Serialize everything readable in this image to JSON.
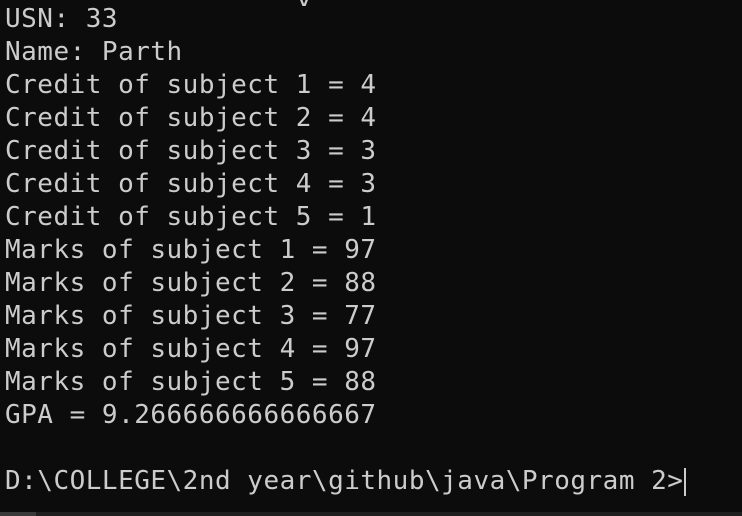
{
  "terminal": {
    "lines": [
      "USN: 33",
      "Name: Parth",
      "Credit of subject 1 = 4",
      "Credit of subject 2 = 4",
      "Credit of subject 3 = 3",
      "Credit of subject 4 = 3",
      "Credit of subject 5 = 1",
      "Marks of subject 1 = 97",
      "Marks of subject 2 = 88",
      "Marks of subject 3 = 77",
      "Marks of subject 4 = 97",
      "Marks of subject 5 = 88",
      "GPA = 9.266666666666667"
    ],
    "prompt": "D:\\COLLEGE\\2nd year\\github\\java\\Program 2>"
  },
  "colors": {
    "background": "#0c0c0c",
    "text": "#cccccc"
  }
}
